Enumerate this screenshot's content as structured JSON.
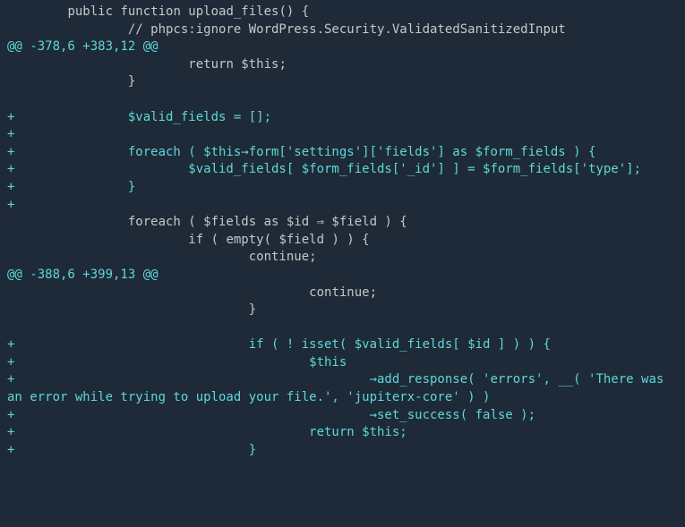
{
  "diff": {
    "lines": [
      {
        "type": "ctx",
        "text": "        public function upload_files() {"
      },
      {
        "type": "ctx",
        "text": "                // phpcs:ignore WordPress.Security.ValidatedSanitizedInput"
      },
      {
        "type": "hunk",
        "text": "@@ -378,6 +383,12 @@"
      },
      {
        "type": "ctx",
        "text": "                        return $this;"
      },
      {
        "type": "ctx",
        "text": "                }"
      },
      {
        "type": "ctx",
        "text": ""
      },
      {
        "type": "add",
        "text": "+               $valid_fields = [];"
      },
      {
        "type": "add",
        "text": "+"
      },
      {
        "type": "add",
        "text": "+               foreach ( $this→form['settings']['fields'] as $form_fields ) {"
      },
      {
        "type": "add",
        "text": "+                       $valid_fields[ $form_fields['_id'] ] = $form_fields['type'];"
      },
      {
        "type": "add",
        "text": "+               }"
      },
      {
        "type": "add",
        "text": "+"
      },
      {
        "type": "ctx",
        "text": "                foreach ( $fields as $id ⇒ $field ) {"
      },
      {
        "type": "ctx",
        "text": "                        if ( empty( $field ) ) {"
      },
      {
        "type": "ctx",
        "text": "                                continue;"
      },
      {
        "type": "hunk",
        "text": "@@ -388,6 +399,13 @@"
      },
      {
        "type": "ctx",
        "text": "                                        continue;"
      },
      {
        "type": "ctx",
        "text": "                                }"
      },
      {
        "type": "ctx",
        "text": ""
      },
      {
        "type": "add",
        "text": "+                               if ( ! isset( $valid_fields[ $id ] ) ) {"
      },
      {
        "type": "add",
        "text": "+                                       $this"
      },
      {
        "type": "add",
        "text": "+                                               →add_response( 'errors', __( 'There was an error while trying to upload your file.', 'jupiterx-core' ) )"
      },
      {
        "type": "add",
        "text": "+                                               →set_success( false );"
      },
      {
        "type": "add",
        "text": "+                                       return $this;"
      },
      {
        "type": "add",
        "text": "+                               }"
      }
    ]
  }
}
